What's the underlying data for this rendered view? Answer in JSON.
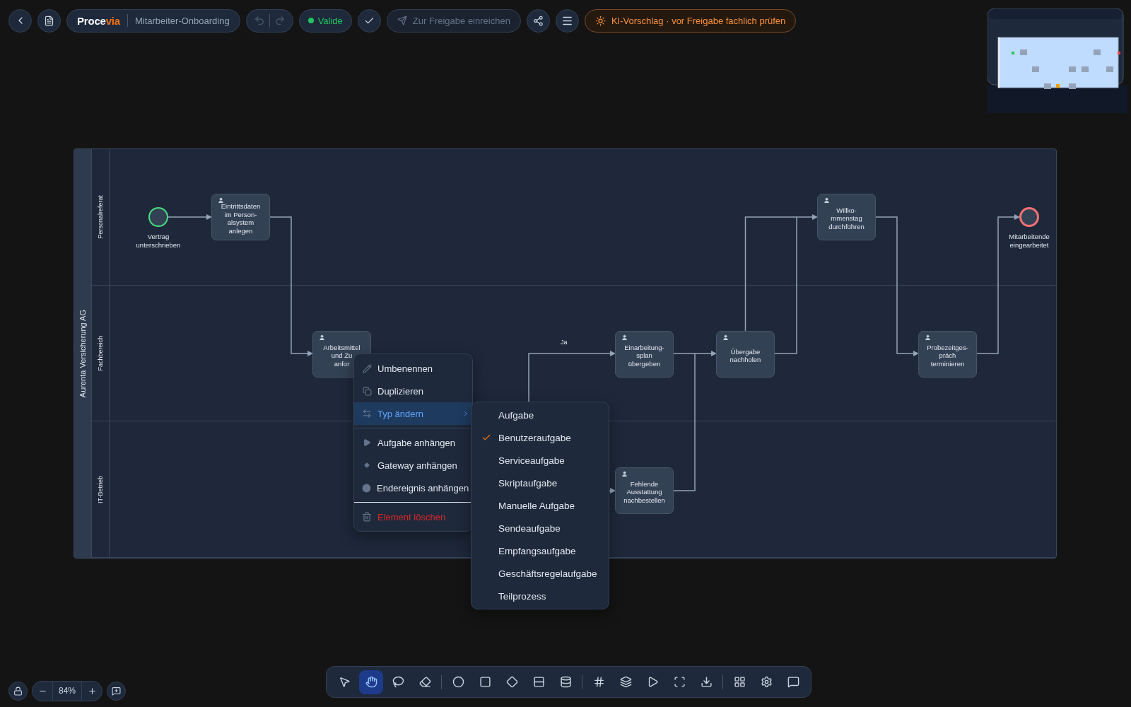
{
  "header": {
    "brand_start": "Proce",
    "brand_accent": "via",
    "document_title": "Mitarbeiter-Onboarding",
    "undo_disabled": true,
    "redo_disabled": true,
    "status": {
      "label": "Valide",
      "valid": true
    },
    "submit": {
      "label": "Zur Freigabe einreichen",
      "disabled": true
    },
    "ai_hint": "KI-Vorschlag · vor Freigabe fachlich prüfen"
  },
  "pool": {
    "name": "Aurenta Versicherung AG",
    "lanes": [
      "Personalreferat",
      "Fachbereich",
      "IT-Betrieb"
    ]
  },
  "nodes": [
    {
      "kind": "start",
      "lines": [
        "Vertrag",
        "unterschrieben"
      ]
    },
    {
      "kind": "user_task",
      "lines": [
        "Eintrittsdaten",
        "im Person-",
        "alsystem",
        "anlegen"
      ]
    },
    {
      "kind": "user_task",
      "lines": [
        "Arbeitsmittel",
        "und Zu",
        "anfor"
      ]
    },
    {
      "kind": "user_task",
      "lines": [
        "Einarbeitung-",
        "splan",
        "übergeben"
      ]
    },
    {
      "kind": "user_task",
      "lines": [
        "Fehlende",
        "Ausstattung",
        "nachbestellen"
      ]
    },
    {
      "kind": "user_task",
      "lines": [
        "Übergabe",
        "nachholen"
      ]
    },
    {
      "kind": "user_task",
      "lines": [
        "Willko-",
        "mmenstag",
        "durchführen"
      ]
    },
    {
      "kind": "user_task",
      "lines": [
        "Probezeitges-",
        "präch",
        "terminieren"
      ]
    },
    {
      "kind": "end",
      "lines": [
        "Mitarbeitende",
        "eingearbeitet"
      ]
    }
  ],
  "edge_labels": [
    "Ja"
  ],
  "context_menu": {
    "sections": [
      [
        {
          "label": "Umbenennen",
          "kind": "rename",
          "selected": false
        },
        {
          "label": "Duplizieren",
          "kind": "duplicate",
          "selected": false
        },
        {
          "label": "Typ ändern",
          "kind": "change_type",
          "selected": true
        }
      ],
      [
        {
          "label": "Aufgabe anhängen",
          "kind": "append_task",
          "selected": false
        },
        {
          "label": "Gateway anhängen",
          "kind": "append_gateway",
          "selected": false
        },
        {
          "label": "Endereignis anhängen",
          "kind": "append_end",
          "selected": false
        }
      ],
      [
        {
          "label": "Element löschen",
          "kind": "delete",
          "selected": false
        }
      ]
    ]
  },
  "type_menu": [
    {
      "label": "Aufgabe",
      "checked": false
    },
    {
      "label": "Benutzeraufgabe",
      "checked": true
    },
    {
      "label": "Serviceaufgabe",
      "checked": false
    },
    {
      "label": "Skriptaufgabe",
      "checked": false
    },
    {
      "label": "Manuelle Aufgabe",
      "checked": false
    },
    {
      "label": "Sendeaufgabe",
      "checked": false
    },
    {
      "label": "Empfangsaufgabe",
      "checked": false
    },
    {
      "label": "Geschäftsregelaufgabe",
      "checked": false
    },
    {
      "label": "Teilprozess",
      "checked": false
    }
  ],
  "zoom_level": "84%",
  "tool_groups": [
    [
      {
        "kind": "select",
        "selected": false
      },
      {
        "kind": "hand",
        "selected": true
      },
      {
        "kind": "lasso",
        "selected": false
      },
      {
        "kind": "eraser",
        "selected": false
      }
    ],
    [
      {
        "kind": "event",
        "selected": false
      },
      {
        "kind": "task",
        "selected": false
      },
      {
        "kind": "gateway",
        "selected": false
      },
      {
        "kind": "lane",
        "selected": false
      },
      {
        "kind": "datastore",
        "selected": false
      }
    ],
    [
      {
        "kind": "grid",
        "selected": false
      },
      {
        "kind": "layers",
        "selected": false
      },
      {
        "kind": "simulate",
        "selected": false
      },
      {
        "kind": "fit",
        "selected": false
      },
      {
        "kind": "export",
        "selected": false
      }
    ],
    [
      {
        "kind": "apps",
        "selected": false
      },
      {
        "kind": "settings",
        "selected": false
      },
      {
        "kind": "comments",
        "selected": false
      }
    ]
  ]
}
